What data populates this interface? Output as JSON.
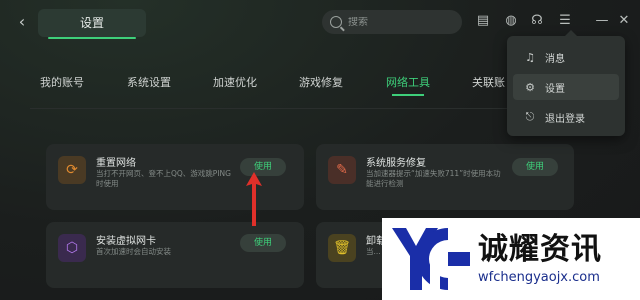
{
  "header": {
    "back_icon": "chevron-left-icon",
    "title": "设置",
    "search_placeholder": "搜索",
    "icons": [
      "mail-icon",
      "speedometer-icon",
      "headset-icon",
      "list-menu-icon"
    ],
    "window": [
      "minimize-icon",
      "close-icon"
    ]
  },
  "nav": {
    "tabs": [
      {
        "label": "我的账号"
      },
      {
        "label": "系统设置"
      },
      {
        "label": "加速优化"
      },
      {
        "label": "游戏修复"
      },
      {
        "label": "网络工具"
      },
      {
        "label": "关联账"
      }
    ],
    "active": "网络工具"
  },
  "cards": [
    {
      "title": "重置网络",
      "desc": "当打不开网页、登不上QQ、游戏跳PING时使用",
      "button": "使用",
      "icon": "refresh-icon",
      "color": "#e08a2f"
    },
    {
      "title": "系统服务修复",
      "desc": "当加速器提示“加速失败711”时使用本功能进行检测",
      "button": "使用",
      "icon": "wrench-icon",
      "color": "#e06a4a"
    },
    {
      "title": "安装虚拟网卡",
      "desc": "首次加速时会自动安装",
      "button": "使用",
      "icon": "cube-icon",
      "color": "#9b5de5"
    },
    {
      "title": "卸载",
      "desc": "当...",
      "button": "",
      "icon": "trash-icon",
      "color": "#d9b21f"
    }
  ],
  "menu": {
    "items": [
      {
        "label": "消息",
        "icon": "bell-icon"
      },
      {
        "label": "设置",
        "icon": "gear-icon"
      },
      {
        "label": "退出登录",
        "icon": "logout-icon"
      }
    ],
    "active": "设置"
  },
  "watermark": {
    "name": "诚耀资讯",
    "url": "wfchengyaojx.com"
  },
  "colors": {
    "accent": "#3ecf7a",
    "annotation_arrow": "#e0302a"
  }
}
